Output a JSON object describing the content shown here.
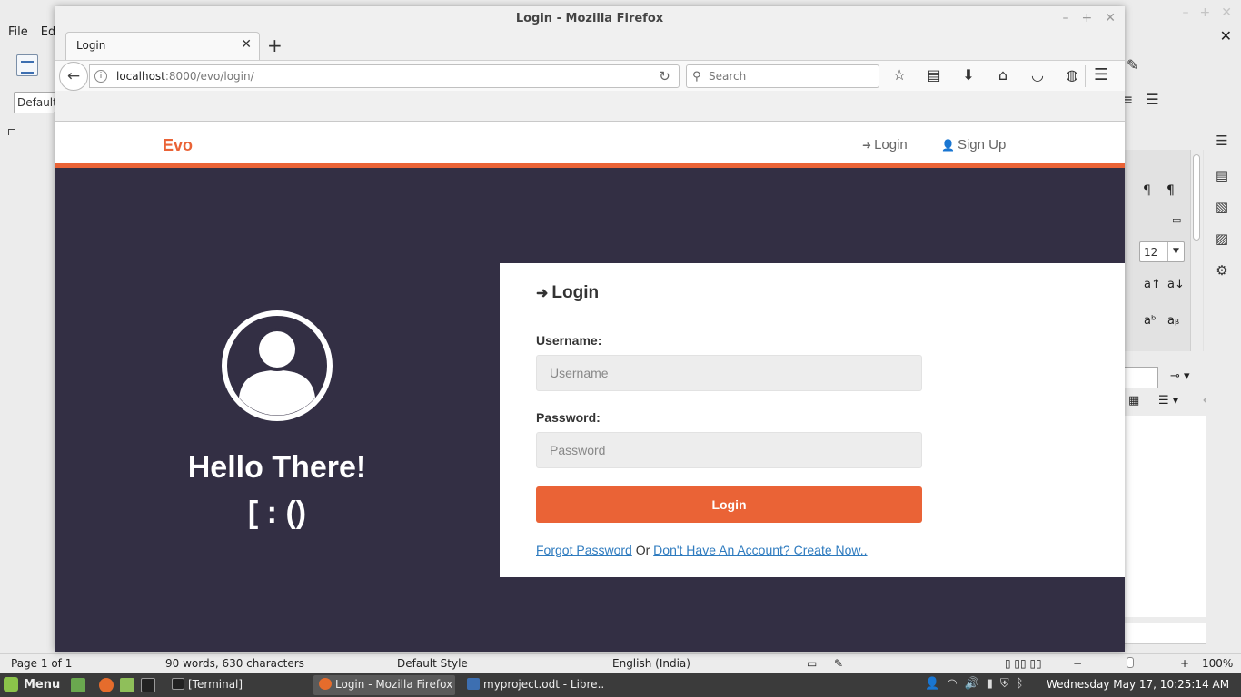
{
  "libreoffice": {
    "menu": [
      "File",
      "Ed"
    ],
    "style_box": "Default",
    "font_size": "12",
    "status": {
      "page": "Page 1 of 1",
      "words": "90 words, 630 characters",
      "style": "Default Style",
      "language": "English (India)",
      "zoom": "100%"
    }
  },
  "firefox": {
    "window_title": "Login - Mozilla Firefox",
    "tab_label": "Login",
    "url_host": "localhost",
    "url_rest": ":8000/evo/login/",
    "search_placeholder": "Search"
  },
  "site": {
    "brand": "Evo",
    "nav": {
      "login": "Login",
      "signup": "Sign Up"
    },
    "greeting": "Hello There!",
    "emoticon": "[ : ()",
    "form": {
      "title": "Login",
      "username_label": "Username:",
      "username_placeholder": "Username",
      "password_label": "Password:",
      "password_placeholder": "Password",
      "submit": "Login",
      "forgot": "Forgot Password",
      "or": "Or",
      "create": "Don't Have An Account? Create Now.."
    },
    "colors": {
      "accent": "#ea6336",
      "hero_bg": "#332f44",
      "link": "#2e7bbf"
    }
  },
  "taskbar": {
    "menu_label": "Menu",
    "tasks": [
      "[Terminal]",
      "Login - Mozilla Firefox",
      "myproject.odt - Libre..."
    ],
    "clock": "Wednesday May 17, 10:25:14 AM"
  }
}
